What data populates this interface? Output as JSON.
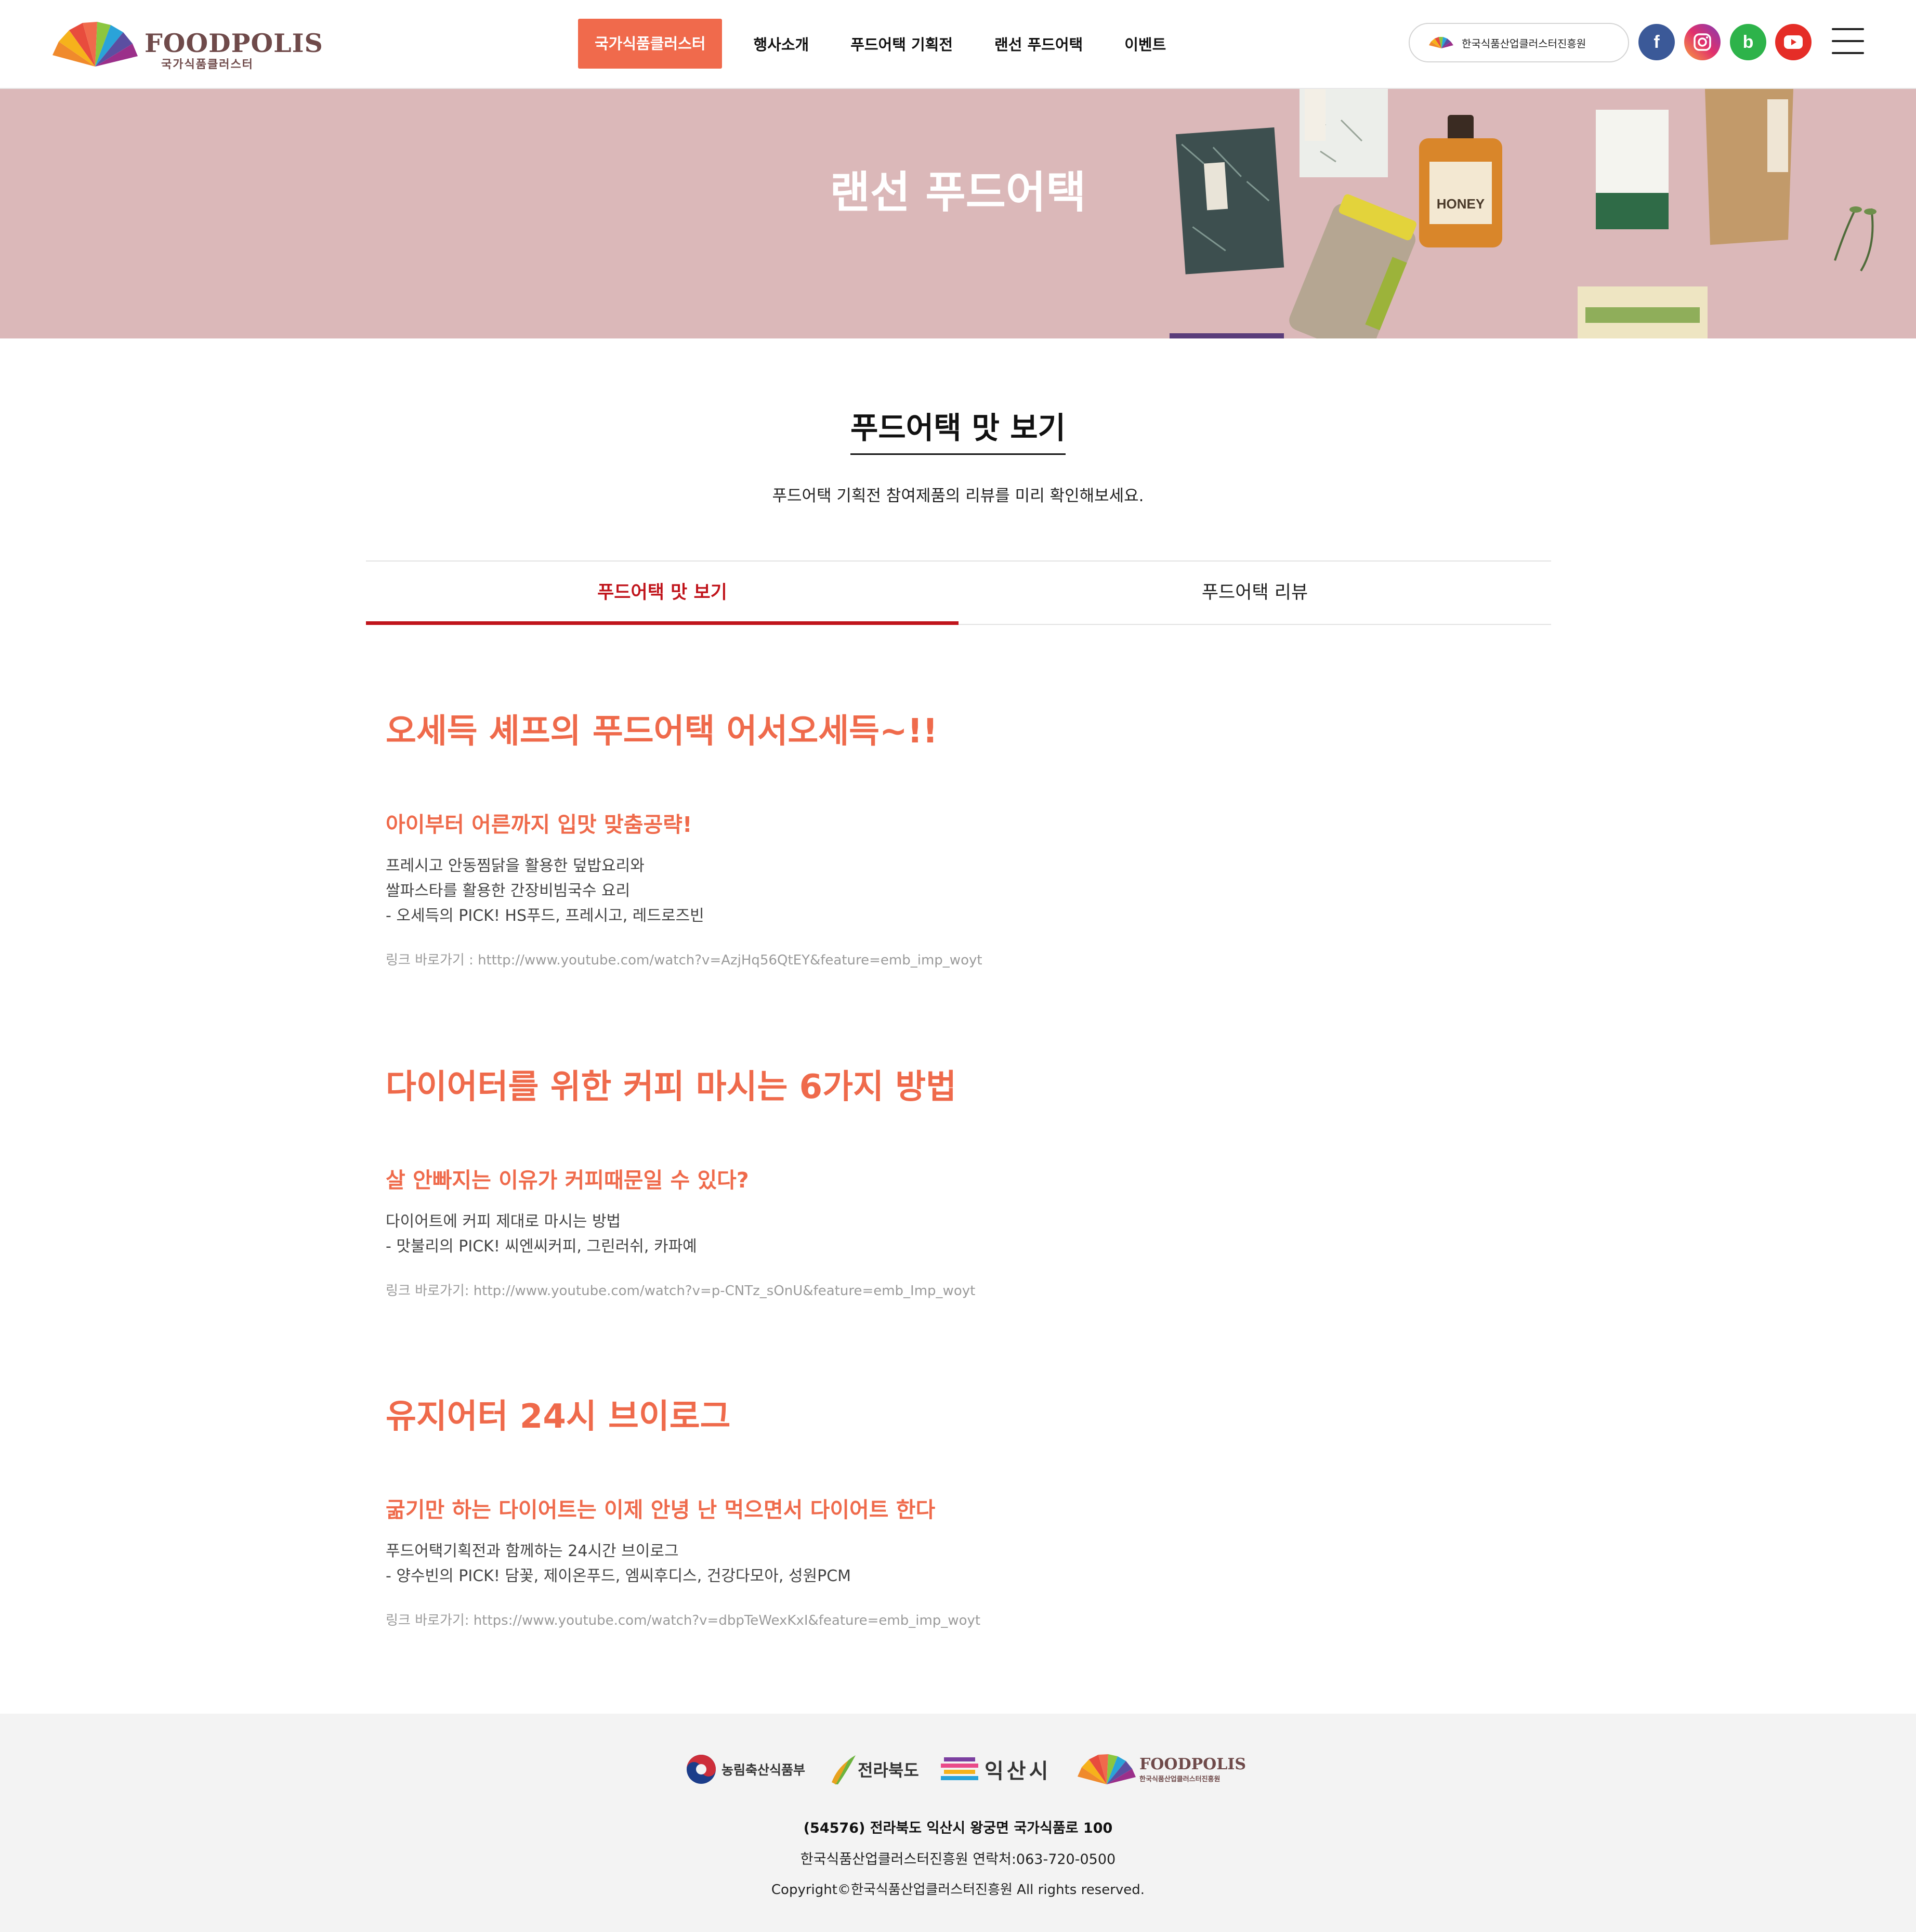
{
  "header": {
    "logo_text": "FOODPOLIS",
    "logo_subtext": "국가식품클러스터",
    "nav": [
      {
        "label": "국가식품클러스터",
        "active": true
      },
      {
        "label": "행사소개",
        "active": false
      },
      {
        "label": "푸드어택 기획전",
        "active": false
      },
      {
        "label": "랜선 푸드어택",
        "active": false
      },
      {
        "label": "이벤트",
        "active": false
      }
    ],
    "org_link_label": "한국식품산업클러스터진흥원",
    "social": [
      {
        "icon": "facebook-icon",
        "glyph": "f",
        "color": "#3b5998"
      },
      {
        "icon": "instagram-icon",
        "glyph": "◎",
        "color": "#e1306c"
      },
      {
        "icon": "blog-icon",
        "glyph": "b",
        "color": "#2db34a"
      },
      {
        "icon": "youtube-icon",
        "glyph": "▶",
        "color": "#e52d27"
      }
    ]
  },
  "banner": {
    "title": "랜선 푸드어택",
    "bg_color": "#dbb8b9"
  },
  "section": {
    "title": "푸드어택 맛 보기",
    "description": "푸드어택 기획전 참여제품의 리뷰를 미리 확인해보세요."
  },
  "tabs": [
    {
      "label": "푸드어택 맛 보기",
      "active": true
    },
    {
      "label": "푸드어택 리뷰",
      "active": false
    }
  ],
  "articles": [
    {
      "title": "오세득 셰프의 푸드어택 어서오세득~!!",
      "subtitle": "아이부터 어른까지 입맛 맞춤공략!",
      "body": [
        "프레시고 안동찜닭을 활용한 덮밥요리와",
        "쌀파스타를 활용한 간장비빔국수 요리",
        "- 오세득의 PICK! HS푸드, 프레시고, 레드로즈빈"
      ],
      "link": "링크 바로가기 : htttp://www.youtube.com/watch?v=AzjHq56QtEY&feature=emb_imp_woyt"
    },
    {
      "title": "다이어터를 위한 커피 마시는 6가지 방법",
      "subtitle": "살 안빠지는 이유가 커피때문일 수 있다?",
      "body": [
        "다이어트에 커피 제대로 마시는 방법",
        "- 맛불리의 PICK! 씨엔씨커피, 그린러쉬, 카파예"
      ],
      "link": "링크 바로가기: http://www.youtube.com/watch?v=p-CNTz_sOnU&feature=emb_Imp_woyt"
    },
    {
      "title": "유지어터 24시 브이로그",
      "subtitle": "굶기만 하는 다이어트는 이제 안녕 난 먹으면서 다이어트 한다",
      "body": [
        "푸드어택기획전과 함께하는 24시간 브이로그",
        "- 양수빈의 PICK! 담꽃, 제이온푸드, 엠씨후디스, 건강다모아, 성원PCM"
      ],
      "link": "링크 바로가기: https://www.youtube.com/watch?v=dbpTeWexKxI&feature=emb_imp_woyt"
    }
  ],
  "footer": {
    "logos": [
      "농림축산식품부",
      "전라북도",
      "익산시",
      "FOODPOLIS"
    ],
    "foodpolis_sub": "한국식품산업클러스터진흥원",
    "address": "(54576) 전라북도 익산시 왕궁면 국가식품로 100",
    "contact": "한국식품산업클러스터진흥원 연락처:063-720-0500",
    "copyright": "Copyright©한국식품산업클러스터진흥원 All rights reserved."
  },
  "colors": {
    "accent": "#ef6a4b",
    "nav_active_bg": "#f06a4c",
    "tab_active": "#c0141b",
    "footer_bg": "#f3f3f3"
  }
}
